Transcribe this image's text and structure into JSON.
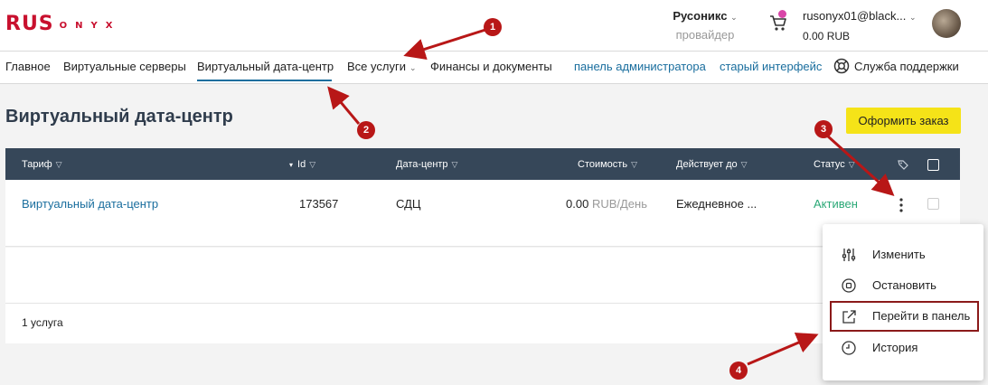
{
  "header": {
    "logo_primary": "RUS",
    "logo_secondary": "ONYX",
    "provider_name": "Русоникс",
    "provider_role": "провайдер",
    "account_email": "rusonyx01@black...",
    "balance": "0.00 RUB",
    "chevron": "⌄"
  },
  "nav": {
    "items": [
      {
        "label": "Главное"
      },
      {
        "label": "Виртуальные серверы"
      },
      {
        "label": "Виртуальный дата-центр"
      },
      {
        "label": "Все услуги"
      },
      {
        "label": "Финансы и документы"
      },
      {
        "label": "панель администратора"
      },
      {
        "label": "старый интерфейс"
      },
      {
        "label": "Служба поддержки"
      }
    ]
  },
  "page": {
    "title": "Виртуальный дата-центр",
    "order_button": "Оформить заказ"
  },
  "table": {
    "columns": [
      {
        "label": "Тариф"
      },
      {
        "label": "Id"
      },
      {
        "label": "Дата-центр"
      },
      {
        "label": "Стоимость"
      },
      {
        "label": "Действует до"
      },
      {
        "label": "Статус"
      }
    ],
    "sort_indicator": "▾",
    "filter_glyph": "▽",
    "rows": [
      {
        "tariff": "Виртуальный дата-центр",
        "id": "173567",
        "datacenter": "СДЦ",
        "cost_value": "0.00",
        "cost_unit": "RUB/День",
        "valid_until": "Ежедневное ...",
        "status": "Активен"
      }
    ],
    "footer_count": "1 услуга"
  },
  "context_menu": {
    "items": [
      {
        "label": "Изменить",
        "icon": "sliders-icon"
      },
      {
        "label": "Остановить",
        "icon": "stop-icon"
      },
      {
        "label": "Перейти в панель",
        "icon": "external-link-icon"
      },
      {
        "label": "История",
        "icon": "clock-icon"
      }
    ]
  },
  "annotations": {
    "markers": [
      "1",
      "2",
      "3",
      "4"
    ],
    "color": "#b81717"
  },
  "colors": {
    "accent": "#1a6e9e",
    "table_header": "#364759",
    "order_button": "#f5e318",
    "status_active": "#2aa876",
    "logo": "#c8102e"
  }
}
